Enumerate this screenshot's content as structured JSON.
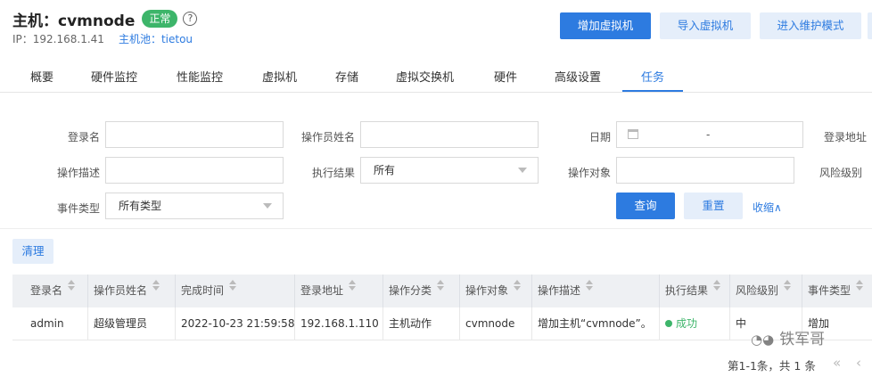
{
  "header": {
    "title": "主机：cvmnode",
    "status": "正常",
    "help_icon": "?",
    "ip": "IP：192.168.1.41",
    "pool": "主机池：tietou"
  },
  "actions": {
    "add_vm": "增加虚拟机",
    "import_vm": "导入虚拟机",
    "maintenance": "进入维护模式"
  },
  "tabs": [
    "概要",
    "硬件监控",
    "性能监控",
    "虚拟机",
    "存储",
    "虚拟交换机",
    "硬件",
    "高级设置",
    "任务"
  ],
  "active_tab": 8,
  "filters": {
    "login_name": "登录名",
    "operator_name": "操作员姓名",
    "date": "日期",
    "date_sep": "-",
    "login_addr": "登录地址",
    "op_desc": "操作描述",
    "exec_result": "执行结果",
    "exec_result_value": "所有",
    "op_target": "操作对象",
    "risk_level": "风险级别",
    "event_type": "事件类型",
    "event_type_value": "所有类型"
  },
  "buttons": {
    "query": "查询",
    "reset": "重置",
    "collapse": "收缩∧",
    "clear": "清理"
  },
  "table": {
    "columns": [
      "登录名",
      "操作员姓名",
      "完成时间",
      "登录地址",
      "操作分类",
      "操作对象",
      "操作描述",
      "执行结果",
      "风险级别",
      "事件类型"
    ],
    "rows": [
      [
        "admin",
        "超级管理员",
        "2022-10-23 21:59:58",
        "192.168.1.110",
        "主机动作",
        "cvmnode",
        "增加主机“cvmnode”。",
        "成功",
        "中",
        "增加"
      ]
    ]
  },
  "pagination": {
    "summary": "第1-1条，共 1 条",
    "arrows": "« ‹"
  },
  "watermark": "铁军哥",
  "colors": {
    "primary": "#2d7be0",
    "success": "#3db56a"
  }
}
